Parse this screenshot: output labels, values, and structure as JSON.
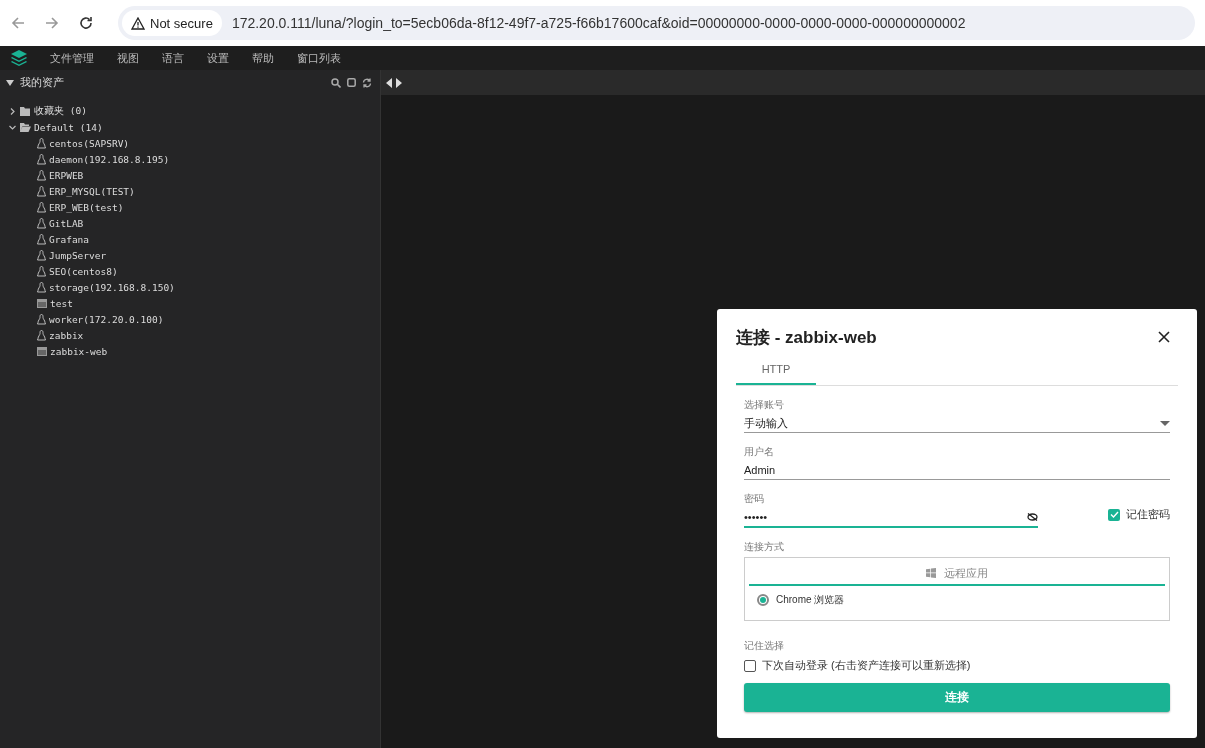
{
  "browser": {
    "security": "Not secure",
    "url": "172.20.0.111/luna/?login_to=5ecb06da-8f12-49f7-a725-f66b17600caf&oid=00000000-0000-0000-0000-000000000002"
  },
  "menu": [
    "文件管理",
    "视图",
    "语言",
    "设置",
    "帮助",
    "窗口列表"
  ],
  "sidebar": {
    "title": "我的资产",
    "expanded": true,
    "tree": [
      {
        "label": "收藏夹 (0)",
        "kind": "folder",
        "expanded": false
      },
      {
        "label": "Default (14)",
        "kind": "folder",
        "expanded": true,
        "children": [
          {
            "label": "centos(SAPSRV)",
            "kind": "linux"
          },
          {
            "label": "daemon(192.168.8.195)",
            "kind": "linux"
          },
          {
            "label": "ERPWEB",
            "kind": "linux"
          },
          {
            "label": "ERP_MYSQL(TEST)",
            "kind": "linux"
          },
          {
            "label": "ERP_WEB(test)",
            "kind": "linux"
          },
          {
            "label": "GitLAB",
            "kind": "linux"
          },
          {
            "label": "Grafana",
            "kind": "linux"
          },
          {
            "label": "JumpServer",
            "kind": "linux"
          },
          {
            "label": "SEO(centos8)",
            "kind": "linux"
          },
          {
            "label": "storage(192.168.8.150)",
            "kind": "linux"
          },
          {
            "label": "test",
            "kind": "web"
          },
          {
            "label": "worker(172.20.0.100)",
            "kind": "linux"
          },
          {
            "label": "zabbix",
            "kind": "linux"
          },
          {
            "label": "zabbix-web",
            "kind": "web"
          }
        ]
      }
    ]
  },
  "dialog": {
    "title": "连接 - zabbix-web",
    "tabs": [
      {
        "label": "HTTP",
        "selected": true
      }
    ],
    "account": {
      "label": "选择账号",
      "value": "手动输入"
    },
    "username": {
      "label": "用户名",
      "value": "Admin"
    },
    "password": {
      "label": "密码",
      "value": "••••••"
    },
    "remember_password": {
      "label": "记住密码",
      "checked": true
    },
    "method": {
      "label": "连接方式",
      "group": "远程应用",
      "options": [
        {
          "label": "Chrome 浏览器",
          "selected": true
        }
      ]
    },
    "remember_choice": {
      "label": "记住选择",
      "option": "下次自动登录 (右击资产连接可以重新选择)",
      "checked": false
    },
    "submit": "连接"
  }
}
